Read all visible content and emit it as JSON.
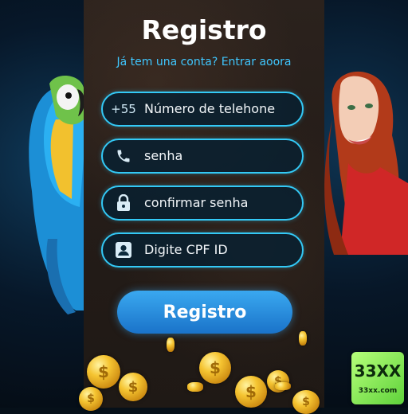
{
  "title": "Registro",
  "subtitle": "Já tem una conta? Entrar aoora",
  "fields": [
    {
      "prefix": "+55",
      "label": "Número de telehone",
      "icon": "country-code-prefix"
    },
    {
      "label": "senha",
      "icon": "phone-icon"
    },
    {
      "label": "confirmar senha",
      "icon": "lock-icon"
    },
    {
      "label": "Digite CPF ID",
      "icon": "id-card-icon"
    }
  ],
  "submit_label": "Registro",
  "badge": {
    "name": "33XX",
    "url": "33xx.com"
  },
  "colors": {
    "accent": "#33c9f6",
    "button": "#1a73c9",
    "panel": "#261e1a",
    "coin": "#f5c431"
  }
}
